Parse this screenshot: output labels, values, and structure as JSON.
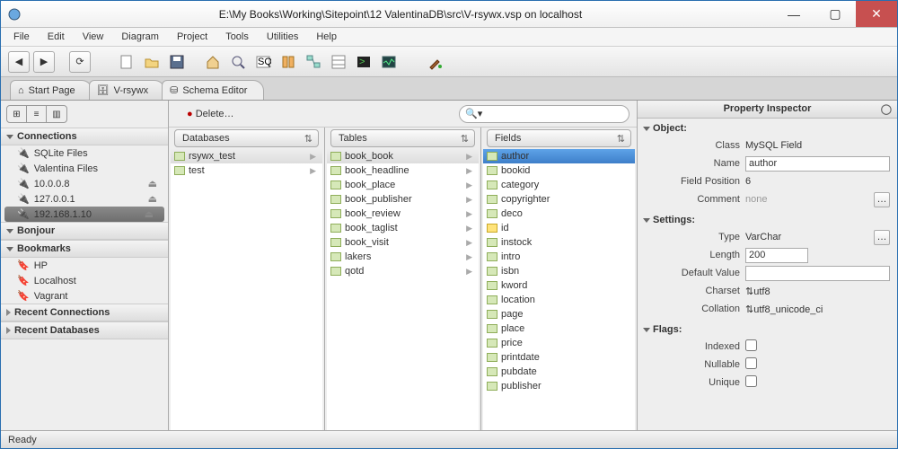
{
  "window": {
    "title": "E:\\My Books\\Working\\Sitepoint\\12 ValentinaDB\\src\\V-rsywx.vsp on localhost"
  },
  "menu": [
    "File",
    "Edit",
    "View",
    "Diagram",
    "Project",
    "Tools",
    "Utilities",
    "Help"
  ],
  "tabs": [
    {
      "label": "Start Page"
    },
    {
      "label": "V-rsywx"
    },
    {
      "label": "Schema Editor"
    }
  ],
  "delete_label": "Delete…",
  "search": {
    "placeholder": ""
  },
  "sidebar": {
    "connections_hdr": "Connections",
    "connections": [
      {
        "label": "SQLite Files"
      },
      {
        "label": "Valentina Files"
      },
      {
        "label": "10.0.0.8",
        "eject": true
      },
      {
        "label": "127.0.0.1",
        "eject": true
      },
      {
        "label": "192.168.1.10",
        "eject": true,
        "selected": true
      }
    ],
    "bonjour_hdr": "Bonjour",
    "bookmarks_hdr": "Bookmarks",
    "bookmarks": [
      "HP",
      "Localhost",
      "Vagrant"
    ],
    "recent_conn_hdr": "Recent Connections",
    "recent_db_hdr": "Recent Databases"
  },
  "columns": {
    "databases": {
      "hdr": "Databases",
      "items": [
        "rsywx_test",
        "test"
      ],
      "selected": 0
    },
    "tables": {
      "hdr": "Tables",
      "items": [
        "book_book",
        "book_headline",
        "book_place",
        "book_publisher",
        "book_review",
        "book_taglist",
        "book_visit",
        "lakers",
        "qotd"
      ],
      "selected": 0
    },
    "fields": {
      "hdr": "Fields",
      "items": [
        "author",
        "bookid",
        "category",
        "copyrighter",
        "deco",
        "id",
        "instock",
        "intro",
        "isbn",
        "kword",
        "location",
        "page",
        "place",
        "price",
        "printdate",
        "pubdate",
        "publisher"
      ],
      "selected": 0,
      "key_index": 5
    }
  },
  "inspector": {
    "title": "Property Inspector",
    "object_hdr": "Object:",
    "class_lbl": "Class",
    "class_val": "MySQL Field",
    "name_lbl": "Name",
    "name_val": "author",
    "fieldpos_lbl": "Field Position",
    "fieldpos_val": "6",
    "comment_lbl": "Comment",
    "comment_val": "none",
    "settings_hdr": "Settings:",
    "type_lbl": "Type",
    "type_val": "VarChar",
    "length_lbl": "Length",
    "length_val": "200",
    "default_lbl": "Default Value",
    "default_val": "",
    "charset_lbl": "Charset",
    "charset_val": "utf8",
    "collation_lbl": "Collation",
    "collation_val": "utf8_unicode_ci",
    "flags_hdr": "Flags:",
    "indexed_lbl": "Indexed",
    "nullable_lbl": "Nullable",
    "unique_lbl": "Unique"
  },
  "status": "Ready"
}
